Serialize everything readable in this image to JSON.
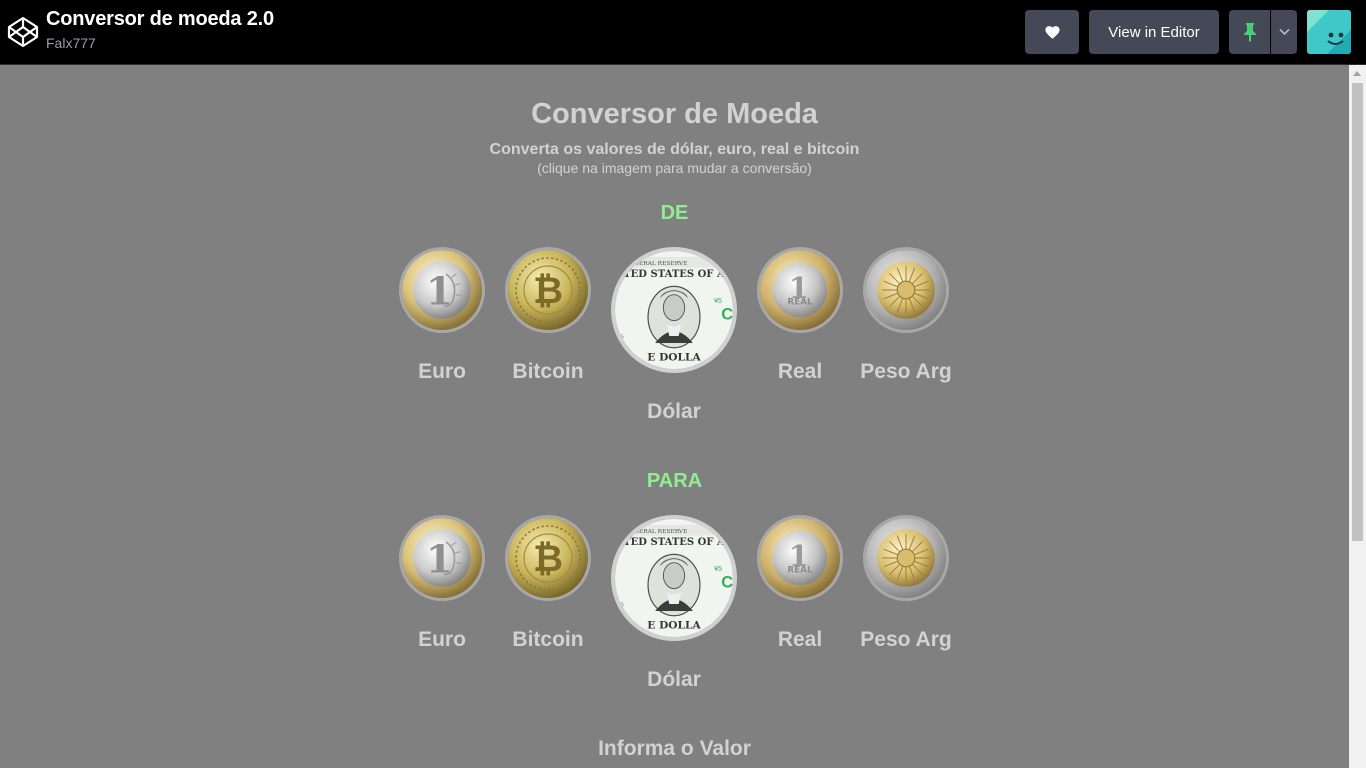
{
  "header": {
    "title": "Conversor de moeda 2.0",
    "author": "Falx777",
    "view_editor_label": "View in Editor",
    "icons": [
      "codepen-logo-icon",
      "heart-icon",
      "pin-icon",
      "chevron-down-icon"
    ]
  },
  "main": {
    "title": "Conversor de Moeda",
    "subtitle": "Converta os valores de dólar, euro, real e bitcoin",
    "hint": "(clique na imagem para mudar a conversão)",
    "from_label": "DE",
    "to_label": "PARA",
    "value_label": "Informa o Valor"
  },
  "currencies": {
    "from": [
      "Euro",
      "Bitcoin",
      "Dólar",
      "Real",
      "Peso Arg"
    ],
    "to": [
      "Euro",
      "Bitcoin",
      "Dólar",
      "Real",
      "Peso Arg"
    ]
  },
  "colors": {
    "topbar_bg": "#000000",
    "page_bg": "#808080",
    "button_bg": "#444857",
    "section_label": "#90ee90",
    "text": "#d2d2d2"
  }
}
